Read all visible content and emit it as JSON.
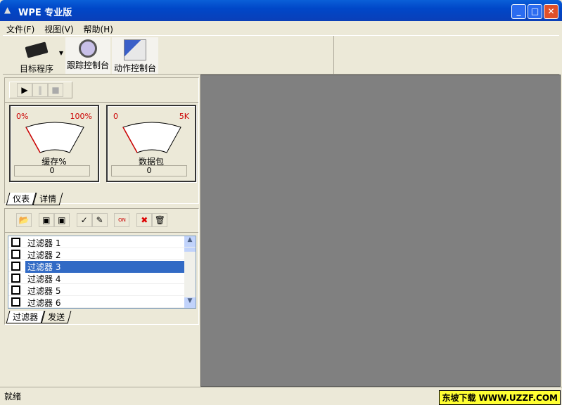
{
  "window": {
    "title": "WPE 专业版",
    "min": "_",
    "max": "□",
    "close": "✕"
  },
  "menu": [
    "文件(F)",
    "视图(V)",
    "帮助(H)"
  ],
  "toolbar": {
    "target": "目标程序",
    "trace": "跟踪控制台",
    "action": "动作控制台"
  },
  "gauges": [
    {
      "min": "0%",
      "max": "100%",
      "label": "缓存%",
      "value": "0"
    },
    {
      "min": "0",
      "max": "5K",
      "label": "数据包",
      "value": "0"
    }
  ],
  "gauge_tabs": [
    "仪表",
    "详情"
  ],
  "filters": [
    "过滤器 1",
    "过滤器 2",
    "过滤器 3",
    "过滤器 4",
    "过滤器 5",
    "过滤器 6"
  ],
  "selected_filter": 2,
  "filter_tabs": [
    "过滤器",
    "发送"
  ],
  "status": "就绪",
  "watermark": "东坡下载 WWW.UZZF.COM"
}
